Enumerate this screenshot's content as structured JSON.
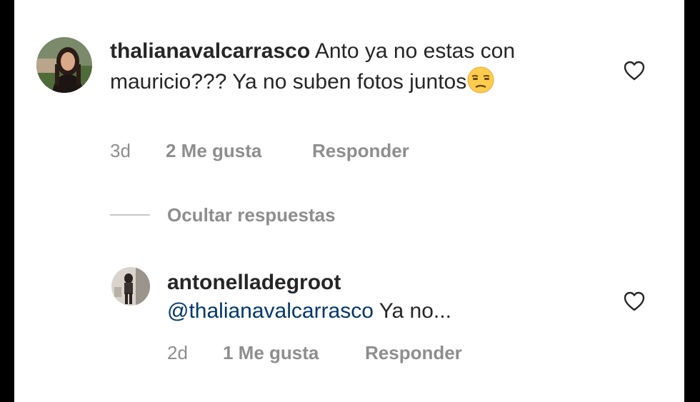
{
  "comments": [
    {
      "username": "thalianavalcarrasco",
      "text": "Anto ya no estas con mauricio??? Ya no suben fotos juntos",
      "emoji": "unamused-face",
      "time": "3d",
      "likes": "2 Me gusta",
      "reply_label": "Responder"
    }
  ],
  "hide_replies_label": "Ocultar respuestas",
  "replies": [
    {
      "username": "antonelladegroot",
      "mention": "@thalianavalcarrasco",
      "text": "Ya no...",
      "time": "2d",
      "likes": "1 Me gusta",
      "reply_label": "Responder"
    }
  ],
  "icons": {
    "like": "heart-outline-icon"
  },
  "colors": {
    "text": "#262626",
    "secondary": "#8e8e8e",
    "mention": "#00376b"
  }
}
